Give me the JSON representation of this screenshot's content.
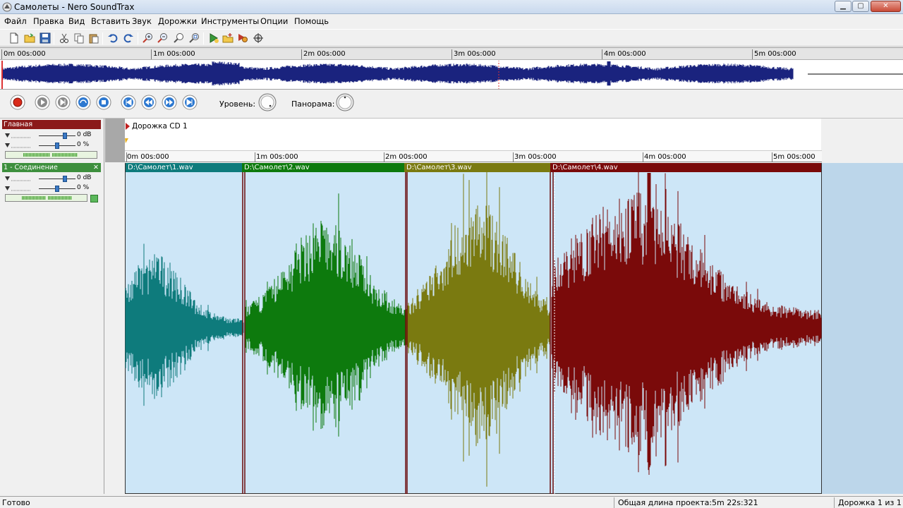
{
  "window": {
    "title": "Самолеты - Nero SoundTrax",
    "minimize_label": "▁",
    "maximize_label": "▢",
    "close_label": "✕"
  },
  "menu": [
    "Файл",
    "Правка",
    "Вид",
    "Вставить",
    "Звук",
    "Дорожки",
    "Инструменты",
    "Опции",
    "Помощь"
  ],
  "toolbar_icons": [
    "new-file-icon",
    "open-folder-icon",
    "save-icon",
    "cut-icon",
    "copy-icon",
    "paste-icon",
    "undo-icon",
    "redo-icon",
    "zoom-in-icon",
    "zoom-out-icon",
    "zoom-selection-icon",
    "zoom-fit-icon",
    "add-audio-icon",
    "add-folder-icon",
    "record-audio-icon",
    "settings-icon"
  ],
  "overview": {
    "ticks": [
      "0m 00s:000",
      "1m 00s:000",
      "2m 00s:000",
      "3m 00s:000",
      "4m 00s:000",
      "5m 00s:000"
    ]
  },
  "transport": {
    "level_label": "Уровень:",
    "pan_label": "Панорама:"
  },
  "tracks_panel": {
    "master": {
      "title": "Главная",
      "volume_value": "0 dB",
      "pan_value": "0 %"
    },
    "track1": {
      "title": "1 - Соединение",
      "close_label": "✕",
      "volume_value": "0 dB",
      "pan_value": "0 %"
    }
  },
  "timeline": {
    "cd_track_label": "Дорожка CD 1",
    "ticks": [
      "0m 00s:000",
      "1m 00s:000",
      "2m 00s:000",
      "3m 00s:000",
      "4m 00s:000",
      "5m 00s:000"
    ]
  },
  "clips": [
    {
      "name": "D:\\Самолет\\1.wav",
      "color": "#0e7b7c"
    },
    {
      "name": "D:\\Самолет\\2.wav",
      "color": "#0d7a0d"
    },
    {
      "name": "D:\\Самолет\\3.wav",
      "color": "#7a7a10"
    },
    {
      "name": "D:\\Самолет\\4.wav",
      "color": "#7a0a0a"
    }
  ],
  "colors": {
    "master_header": "#8b1a1a",
    "track_header": "#3d8f3d",
    "overview_wave": "#1a237e",
    "accent": "#3a78c4"
  },
  "status": {
    "ready": "Готово",
    "project_length": "Общая длина проекта:5m 22s:321",
    "track_counter": "Дорожка 1 из 1"
  }
}
